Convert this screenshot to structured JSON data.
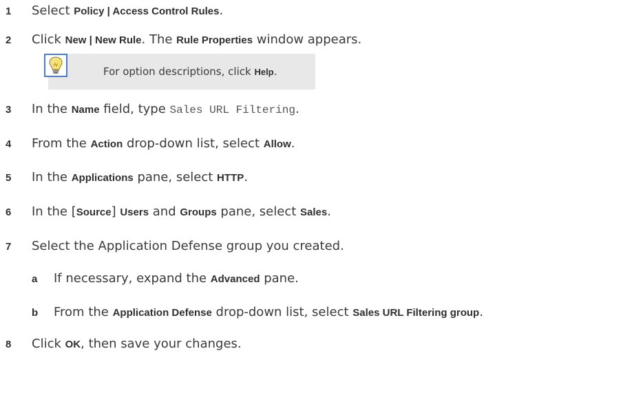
{
  "steps": [
    {
      "num": "1",
      "parts": [
        "Select ",
        "Policy | Access Control Rules",
        "."
      ]
    },
    {
      "num": "2",
      "parts": [
        "Click ",
        "New | New Rule",
        ". The ",
        "Rule Properties",
        " window appears."
      ]
    },
    {
      "num": "3",
      "parts": [
        "In the ",
        "Name",
        " field, type ",
        "Sales URL Filtering",
        "."
      ]
    },
    {
      "num": "4",
      "parts": [
        "From the ",
        "Action",
        " drop-down list, select ",
        "Allow",
        "."
      ]
    },
    {
      "num": "5",
      "parts": [
        "In the ",
        "Applications",
        " pane, select ",
        "HTTP",
        "."
      ]
    },
    {
      "num": "6",
      "parts": [
        "In the [",
        "Source",
        "] ",
        "Users",
        " and ",
        "Groups",
        " pane, select ",
        "Sales",
        "."
      ]
    },
    {
      "num": "7",
      "parts": [
        "Select the Application Defense group you created."
      ]
    },
    {
      "num": "a",
      "parts": [
        "If necessary, expand the ",
        "Advanced",
        " pane."
      ]
    },
    {
      "num": "b",
      "parts": [
        "From the ",
        "Application Defense",
        " drop-down list, select ",
        "Sales URL Filtering group",
        "."
      ]
    },
    {
      "num": "8",
      "parts": [
        "Click ",
        "OK",
        ", then save your changes."
      ]
    }
  ],
  "tip": {
    "icon": "lightbulb-icon",
    "parts": [
      "For option descriptions, click ",
      "Help",
      "."
    ]
  },
  "colors": {
    "text": "#3a3a3a",
    "tip_bg": "#e8e8e8",
    "icon_border": "#4a7bc8",
    "bulb": "#f5e27a"
  }
}
